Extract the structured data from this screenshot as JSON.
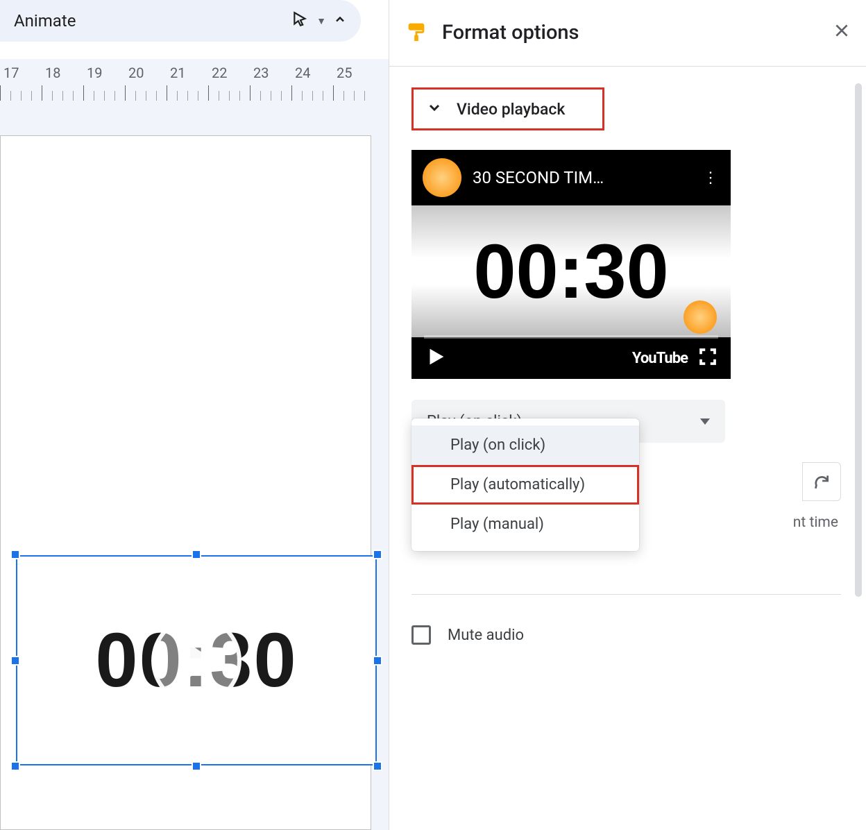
{
  "toolbar": {
    "animate_label": "Animate"
  },
  "ruler": {
    "marks": [
      17,
      18,
      19,
      20,
      21,
      22,
      23,
      24,
      25
    ]
  },
  "canvas_video": {
    "timer_text": "00:30"
  },
  "panel": {
    "title": "Format options",
    "section_title": "Video playback",
    "youtube": {
      "title": "30 SECOND TIM…",
      "timer": "00:30",
      "brand": "YouTube"
    },
    "dropdown_value": "Play (on click)",
    "options": [
      "Play (on click)",
      "Play (automatically)",
      "Play (manual)"
    ],
    "reload_hint_tail": "nt time",
    "mute_label": "Mute audio"
  }
}
